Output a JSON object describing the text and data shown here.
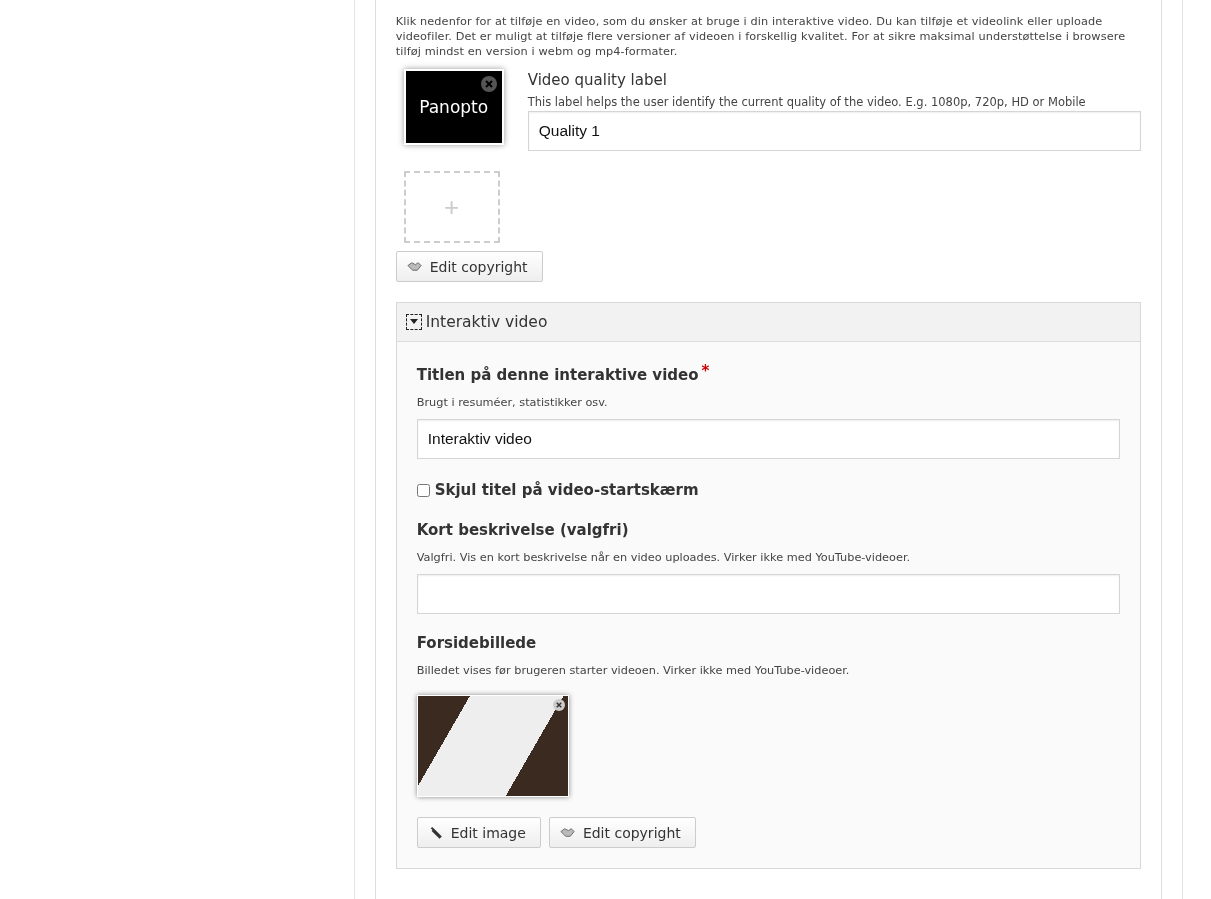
{
  "video_section": {
    "description": "Klik nedenfor for at tilføje en video, som du ønsker at bruge i din interaktive video. Du kan tilføje et videolink eller uploade videofiler. Det er muligt at tilføje flere versioner af videoen i forskellig kvalitet. For at sikre maksimal understøttelse i browsere tilføj mindst en version i webm og mp4-formater.",
    "video_thumbnail": "Panopto",
    "quality_label": {
      "label": "Video quality label",
      "description": "This label helps the user identify the current quality of the video. E.g. 1080p, 720p, HD or Mobile",
      "value": "Quality 1"
    },
    "add_button": "+",
    "copyright_button": "Edit copyright"
  },
  "group": {
    "title": "Interaktiv video",
    "expanded": true,
    "title_field": {
      "label": "Titlen på denne interaktive video",
      "required_mark": "*",
      "description": "Brugt i resuméer, statistikker osv.",
      "value": "Interaktiv video"
    },
    "hide_title": {
      "label": "Skjul titel på video-startskærm",
      "checked": false
    },
    "short_description": {
      "label": "Kort beskrivelse (valgfri)",
      "description": "Valgfri. Vis en kort beskrivelse når en video uploades. Virker ikke med YouTube-videoer."
    },
    "cover_image": {
      "label": "Forsidebillede",
      "description": "Billedet vises før brugeren starter videoen. Virker ikke med YouTube-videoer.",
      "buttons": [
        "Edit image",
        "Edit copyright"
      ]
    }
  }
}
